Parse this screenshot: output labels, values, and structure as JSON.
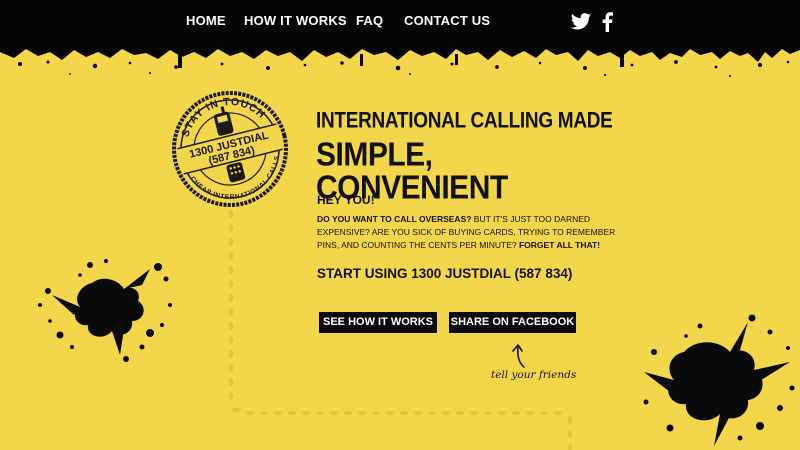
{
  "nav": {
    "items": [
      {
        "label": "HOME"
      },
      {
        "label": "HOW IT WORKS"
      },
      {
        "label": "FAQ"
      },
      {
        "label": "CONTACT US"
      }
    ],
    "social": [
      "twitter-icon",
      "facebook-icon"
    ]
  },
  "stamp": {
    "top_text": "STAY IN TOUCH",
    "line1": "1300 JUSTDIAL",
    "line2": "(587 834)",
    "bottom_text": "CHEAP INTERNATIONAL CALLS"
  },
  "headline": {
    "line1": "INTERNATIONAL CALLING MADE",
    "line2": "SIMPLE, CONVENIENT"
  },
  "intro": {
    "greeting": "HEY YOU!",
    "q1": "DO YOU WANT TO CALL OVERSEAS?",
    "p1": " BUT IT'S JUST TOO DARNED EXPENSIVE? ARE YOU SICK OF BUYING CARDS, TRYING TO REMEMBER PINS, AND COUNTING THE CENTS PER MINUTE? ",
    "p2": "FORGET ALL THAT!",
    "cta": "START USING 1300 JUSTDIAL (587 834)"
  },
  "buttons": {
    "how": "SEE HOW IT WORKS",
    "share": "SHARE ON FACEBOOK"
  },
  "note": "tell your friends",
  "colors": {
    "background": "#f4d64a",
    "ink": "#0a0a0a",
    "accent_trail": "#e8c530"
  }
}
